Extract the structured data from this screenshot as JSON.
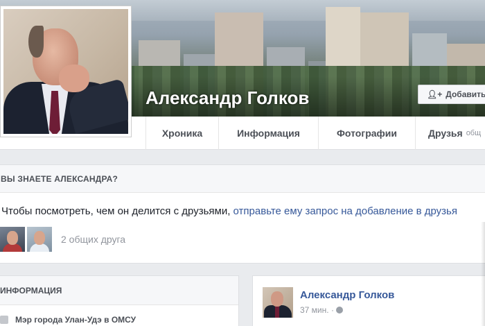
{
  "profile": {
    "name": "Александр Голков",
    "add_friend_label": "Добавить в"
  },
  "nav": {
    "tabs": [
      {
        "label": "Хроника",
        "selected": true
      },
      {
        "label": "Информация"
      },
      {
        "label": "Фотографии"
      },
      {
        "label": "Друзья",
        "sub": "общ"
      }
    ]
  },
  "know_card": {
    "heading": "ВЫ ЗНАЕТЕ АЛЕКСАНДРА?",
    "text": "Чтобы посмотреть, чем он делится с друзьями, ",
    "link_text": "отправьте ему запрос на добавление в друзья",
    "mutual_text": "2 общих друга"
  },
  "info_card": {
    "heading": "ИНФОРМАЦИЯ",
    "row": "Мэр города Улан-Удэ в ОМСУ"
  },
  "post": {
    "author": "Александр Голков",
    "time": "37 мин."
  },
  "colors": {
    "link": "#365899",
    "background": "#e9ebee",
    "muted": "#90949c"
  }
}
